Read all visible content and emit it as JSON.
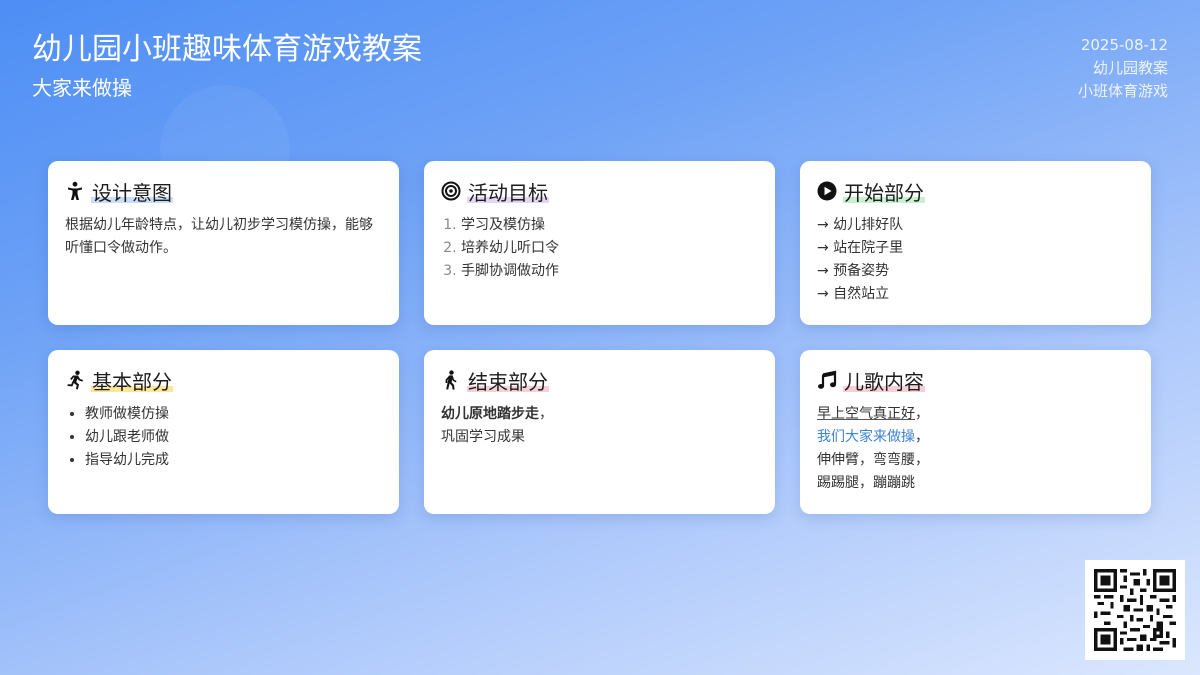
{
  "header": {
    "title": "幼儿园小班趣味体育游戏教案",
    "subtitle": "大家来做操",
    "date": "2025-08-12",
    "tag1": "幼儿园教案",
    "tag2": "小班体育游戏"
  },
  "cards": {
    "design": {
      "title": "设计意图",
      "icon": "child-icon",
      "text": "根据幼儿年龄特点，让幼儿初步学习模仿操，能够听懂口令做动作。"
    },
    "goals": {
      "title": "活动目标",
      "icon": "target-icon",
      "items": [
        "学习及模仿操",
        "培养幼儿听口令",
        "手脚协调做动作"
      ]
    },
    "start": {
      "title": "开始部分",
      "icon": "play-circle-icon",
      "items": [
        "→ 幼儿排好队",
        "→ 站在院子里",
        "→ 预备姿势",
        "→ 自然站立"
      ]
    },
    "basic": {
      "title": "基本部分",
      "icon": "running-icon",
      "items": [
        "教师做模仿操",
        "幼儿跟老师做",
        "指导幼儿完成"
      ]
    },
    "ending": {
      "title": "结束部分",
      "icon": "walking-icon",
      "bold": "幼儿原地踏步走",
      "comma": "，",
      "text": "巩固学习成果"
    },
    "song": {
      "title": "儿歌内容",
      "icon": "music-icon",
      "line1": "早上空气真正好",
      "line1_end": "，",
      "line2": "我们大家来做操",
      "line2_end": "，",
      "line3": "伸伸臂，弯弯腰，",
      "line4": "踢踢腿，蹦蹦跳"
    }
  },
  "colors": {
    "background_start": "#4d8ef5",
    "background_end": "#dbe7fe",
    "link_blue": "#3b82d6"
  }
}
